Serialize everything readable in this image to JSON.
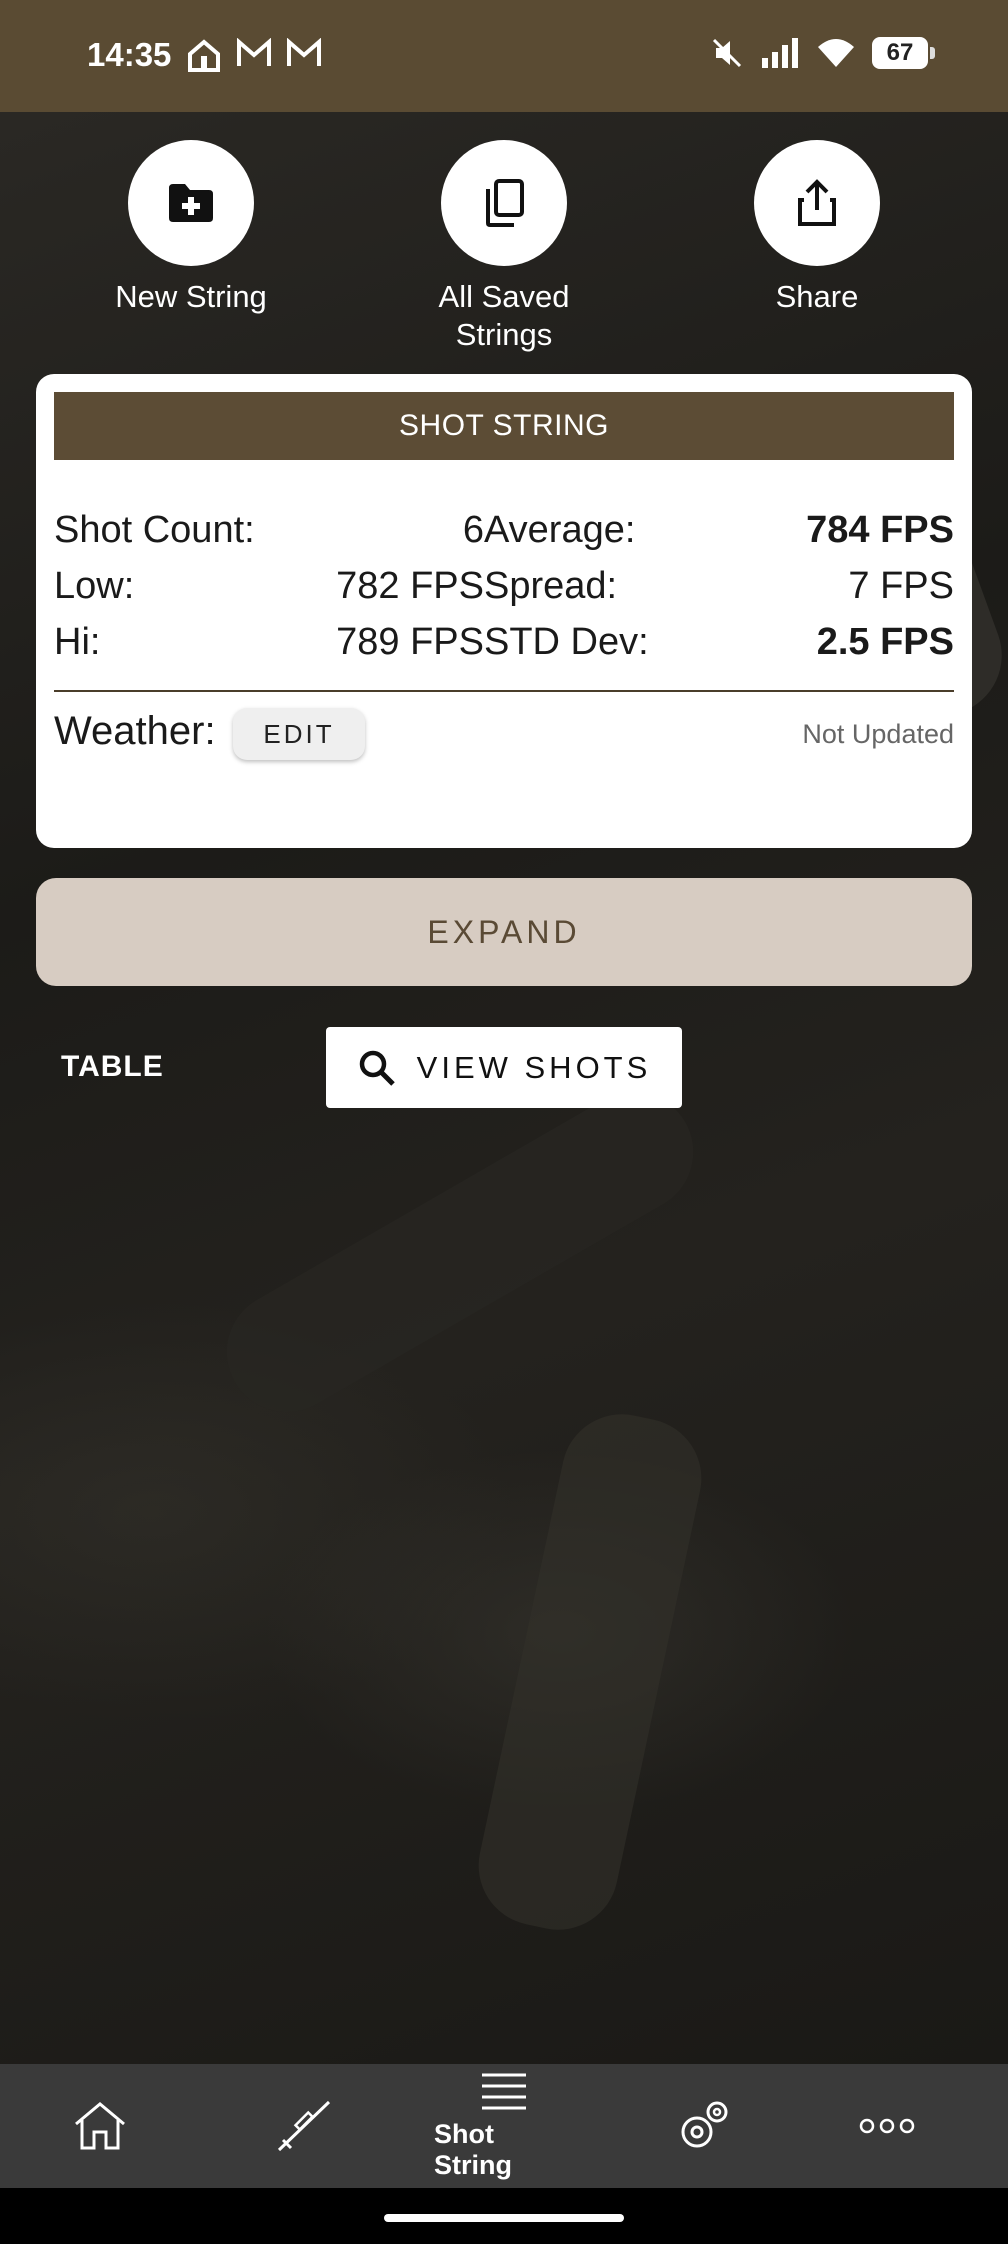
{
  "status_bar": {
    "time": "14:35",
    "left_icons": [
      "home-alert-icon",
      "gmail-icon",
      "gmail-icon"
    ],
    "right_icons": [
      "mute-icon",
      "signal-icon",
      "wifi-icon"
    ],
    "battery": "67"
  },
  "actions": [
    {
      "label": "New String",
      "icon": "new-folder-icon"
    },
    {
      "label": "All Saved Strings",
      "icon": "copy-icon"
    },
    {
      "label": "Share",
      "icon": "share-icon"
    }
  ],
  "card": {
    "header": "SHOT STRING",
    "shot_count_label": "Shot Count:",
    "shot_count_value": "6",
    "low_label": "Low:",
    "low_value": "782 FPS",
    "hi_label": "Hi:",
    "hi_value": "789 FPS",
    "average_label": "Average:",
    "average_value": "784 FPS",
    "spread_label": "Spread:",
    "spread_value": "7 FPS",
    "std_label": "STD Dev:",
    "std_value": "2.5 FPS",
    "weather_label": "Weather:",
    "edit_label": "EDIT",
    "weather_status": "Not Updated"
  },
  "expand_label": "EXPAND",
  "table_label": "TABLE",
  "view_shots_label": "VIEW SHOTS",
  "bottom_nav": {
    "items": [
      {
        "icon": "home-icon"
      },
      {
        "icon": "rifle-icon"
      },
      {
        "icon": "list-icon",
        "label": "Shot String",
        "active": true
      },
      {
        "icon": "settings-icon"
      },
      {
        "icon": "more-icon"
      }
    ]
  },
  "colors": {
    "brand_brown": "#5c4c35",
    "expand_bg": "#d7ccc2",
    "nav_bg": "#3a3a3a"
  }
}
